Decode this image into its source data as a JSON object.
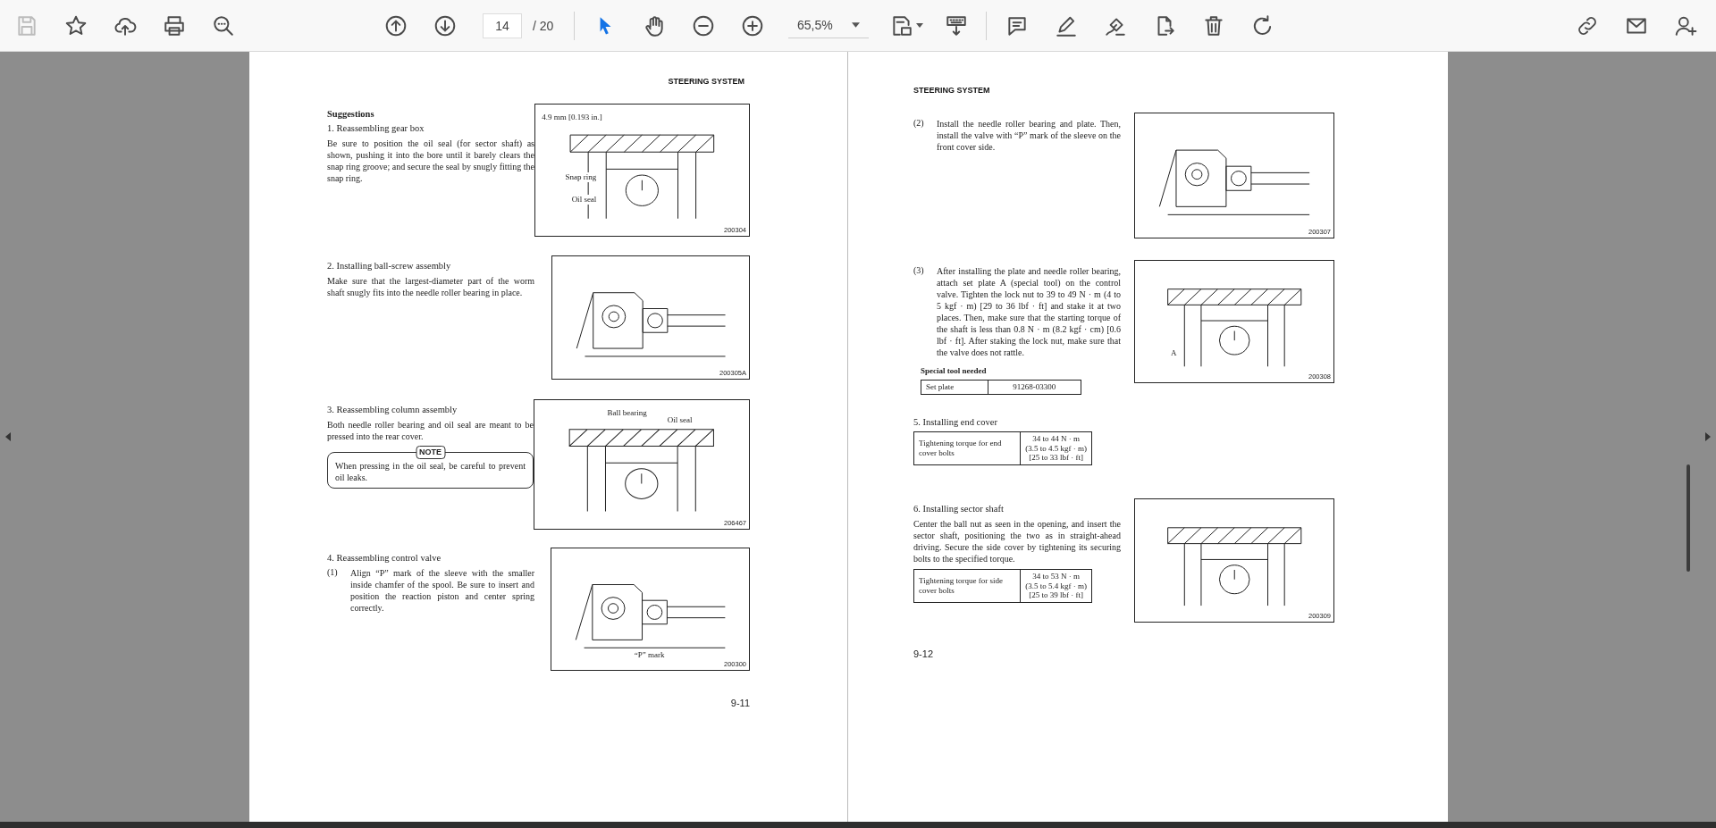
{
  "toolbar": {
    "save_button": {
      "disabled": true
    },
    "page_field": {
      "value": "14"
    },
    "page_total": "/ 20",
    "zoom_field": {
      "value": "65,5%"
    },
    "tools": [
      {
        "kind": "select",
        "selected": true
      },
      {
        "kind": "hand",
        "selected": false
      }
    ]
  },
  "pages": [
    {
      "header": "STEERING SYSTEM",
      "page_number": "9-11",
      "rows": [
        {
          "blocks": [
            {
              "kind": "heading",
              "text": "Suggestions"
            },
            {
              "kind": "subheading",
              "text": "1. Reassembling gear box"
            },
            {
              "kind": "paragraph",
              "text": "Be sure to position the oil seal (for sector shaft) as shown, pushing it into the bore until it barely clears the snap ring groove; and secure the seal by snugly fitting the snap ring."
            }
          ],
          "figure": {
            "number": "200304",
            "labels": [
              "4.9 mm [0.193 in.]",
              "Snap ring",
              "Oil seal"
            ]
          }
        },
        {
          "blocks": [
            {
              "kind": "subheading",
              "text": "2. Installing ball-screw assembly"
            },
            {
              "kind": "paragraph",
              "text": "Make sure that the largest-diameter part of the worm shaft snugly fits into the needle roller bearing in place."
            }
          ],
          "figure": {
            "number": "200305A"
          }
        },
        {
          "blocks": [
            {
              "kind": "subheading",
              "text": "3. Reassembling column assembly"
            },
            {
              "kind": "paragraph",
              "text": "Both needle roller bearing and oil seal are meant to be pressed into the rear cover."
            },
            {
              "kind": "note",
              "label": "NOTE",
              "text": "When pressing in the oil seal, be careful to prevent oil leaks."
            }
          ],
          "figure": {
            "number": "206467",
            "labels": [
              "Ball bearing",
              "Oil seal"
            ]
          }
        },
        {
          "blocks": [
            {
              "kind": "subheading",
              "text": "4. Reassembling control valve"
            },
            {
              "kind": "step",
              "marker": "(1)",
              "text": "Align “P” mark of the sleeve with the smaller inside chamfer of the spool. Be sure to insert and position the reaction piston and center spring correctly."
            }
          ],
          "figure": {
            "number": "200300",
            "labels": [
              "“P” mark"
            ]
          }
        }
      ]
    },
    {
      "header": "STEERING SYSTEM",
      "page_number": "9-12",
      "rows": [
        {
          "blocks": [
            {
              "kind": "step",
              "marker": "(2)",
              "text": "Install the needle roller bearing and plate. Then, install the valve with “P” mark of the sleeve on the front cover side."
            }
          ],
          "figure": {
            "number": "200307"
          }
        },
        {
          "blocks": [
            {
              "kind": "step",
              "marker": "(3)",
              "text": "After installing the plate and needle roller bearing, attach set plate A (special tool) on the control valve. Tighten the lock nut to 39 to 49 N · m (4 to 5 kgf · m) [29 to 36 lbf · ft] and stake it at two places. Then, make sure that the starting torque of the shaft is less than 0.8 N · m (8.2 kgf · cm) [0.6 lbf · ft]. After staking the lock nut, make sure that the valve does not rattle."
            },
            {
              "kind": "caption",
              "text": "Special tool needed"
            },
            {
              "kind": "table",
              "rows": [
                [
                  "Set plate",
                  "91268-03300"
                ]
              ]
            }
          ],
          "figure": {
            "number": "200308",
            "labels": [
              "A"
            ]
          }
        },
        {
          "blocks": [
            {
              "kind": "subheading",
              "text": "5. Installing end cover"
            },
            {
              "kind": "table",
              "rows": [
                [
                  "Tightening torque for end cover bolts",
                  "34 to 44 N · m\n(3.5 to 4.5 kgf · m)\n[25 to 33 lbf · ft]"
                ]
              ]
            }
          ]
        },
        {
          "blocks": [
            {
              "kind": "subheading",
              "text": "6. Installing sector shaft"
            },
            {
              "kind": "paragraph",
              "text": "Center the ball nut as seen in the opening, and insert the sector shaft, positioning the two as in straight-ahead driving.  Secure the side cover by tightening its securing bolts to the specified torque."
            },
            {
              "kind": "table",
              "rows": [
                [
                  "Tightening torque for side cover bolts",
                  "34 to 53 N · m\n(3.5 to 5.4 kgf · m)\n[25 to 39 lbf · ft]"
                ]
              ]
            }
          ],
          "figure": {
            "number": "200309"
          }
        }
      ]
    }
  ]
}
